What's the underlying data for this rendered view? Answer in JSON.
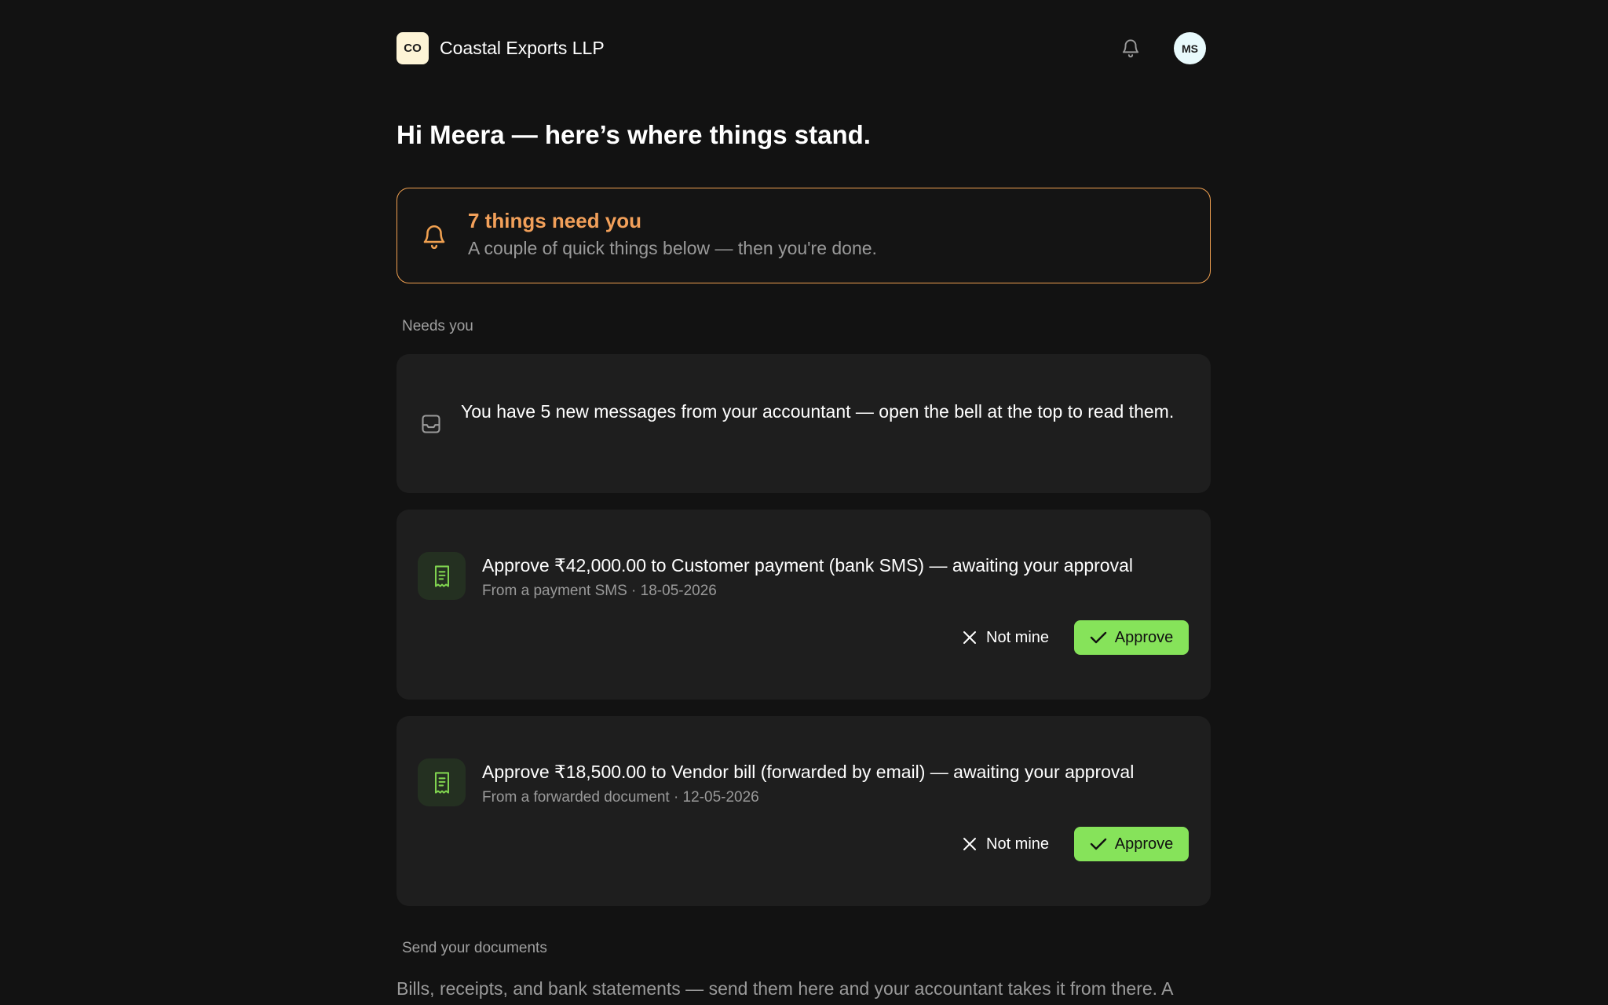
{
  "header": {
    "org_initials": "CO",
    "org_name": "Coastal Exports LLP",
    "user_initials": "MS"
  },
  "greeting": "Hi Meera — here’s where things stand.",
  "alert": {
    "title": "7 things need you",
    "subtitle": "A couple of quick things below — then you're done."
  },
  "needs_you": {
    "label": "Needs you",
    "message_card": {
      "text": "You have 5 new messages from your accountant — open the bell at the top to read them."
    },
    "approvals": [
      {
        "title": "Approve ₹42,000.00 to Customer payment (bank SMS) — awaiting your approval",
        "meta": "From a payment SMS · 18-05-2026",
        "not_mine_label": "Not mine",
        "approve_label": "Approve"
      },
      {
        "title": "Approve ₹18,500.00 to Vendor bill (forwarded by email) — awaiting your approval",
        "meta": "From a forwarded document · 12-05-2026",
        "not_mine_label": "Not mine",
        "approve_label": "Approve"
      }
    ]
  },
  "send_documents": {
    "label": "Send your documents",
    "description": "Bills, receipts, and bank statements — send them here and your accountant takes it from there. A"
  },
  "colors": {
    "background": "#121212",
    "card": "#1e1e1e",
    "alert_accent": "#f0a050",
    "approve_green": "#86e35a"
  },
  "icons": [
    "bell-icon",
    "inbox-icon",
    "receipt-icon",
    "close-icon",
    "check-icon"
  ]
}
